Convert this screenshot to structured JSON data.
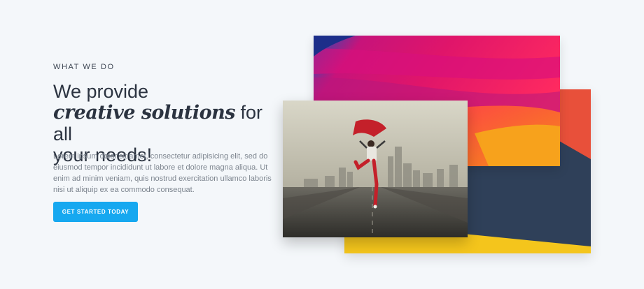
{
  "hero": {
    "eyebrow": "WHAT WE DO",
    "headline_line1": "We provide",
    "headline_emphasis": "creative solutions",
    "headline_line2_rest": " for all",
    "headline_line3": "your needs!",
    "body": "Lorem ipsum dolor sit amet, consectetur adipisicing elit, sed do eiusmod tempor incididunt ut labore et dolore magna aliqua. Ut enim ad minim veniam, quis nostrud exercitation ullamco laboris nisi ut aliquip ex ea commodo consequat.",
    "cta_label": "GET STARTED TODAY"
  },
  "colors": {
    "background": "#f4f7fa",
    "cta": "#16a8f0",
    "heading": "#2b3340",
    "body_text": "#7d858f",
    "navy": "#2f4059",
    "yellow": "#f4c51c",
    "orange_red": "#e8503a"
  },
  "images": {
    "back": "colorful-fabric-photo",
    "front": "dancer-on-road-photo"
  }
}
